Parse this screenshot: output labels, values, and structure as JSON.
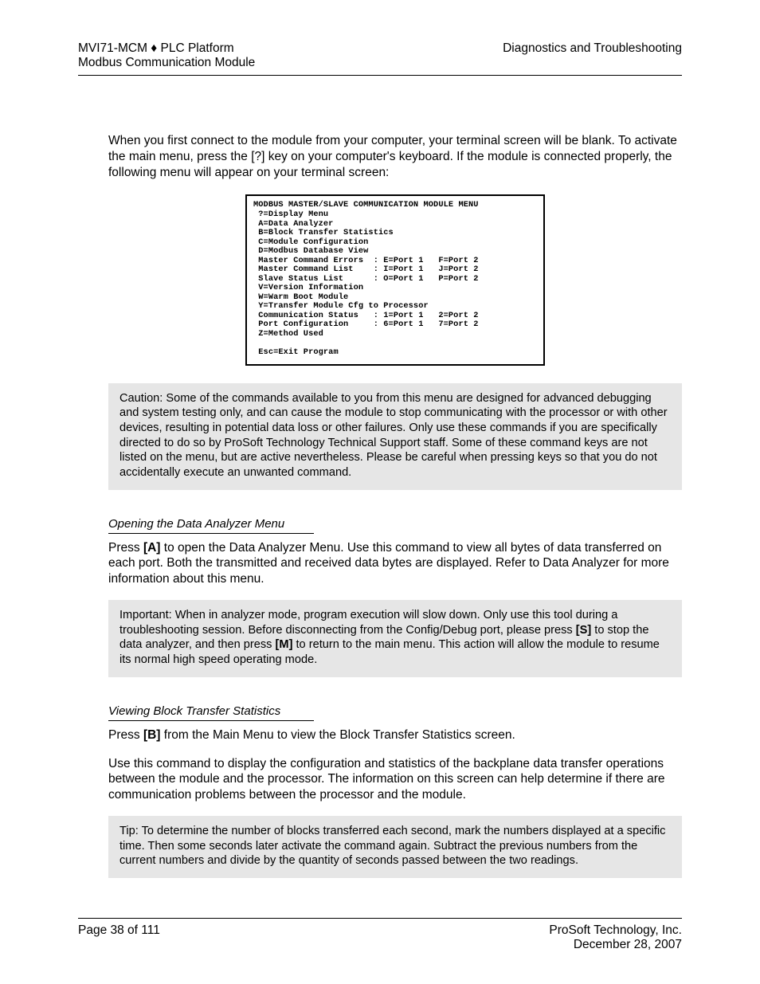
{
  "header": {
    "left_line1": "MVI71-MCM ♦ PLC Platform",
    "left_line2": "Modbus Communication Module",
    "right": "Diagnostics and Troubleshooting"
  },
  "intro": "When you first connect to the module from your computer, your terminal screen will be blank. To activate the main menu, press the [?] key on your computer's keyboard. If the module is connected properly, the following menu will appear on your terminal screen:",
  "terminal": "MODBUS MASTER/SLAVE COMMUNICATION MODULE MENU\n ?=Display Menu\n A=Data Analyzer\n B=Block Transfer Statistics\n C=Module Configuration\n D=Modbus Database View\n Master Command Errors  : E=Port 1   F=Port 2\n Master Command List    : I=Port 1   J=Port 2\n Slave Status List      : O=Port 1   P=Port 2\n V=Version Information\n W=Warm Boot Module\n Y=Transfer Module Cfg to Processor\n Communication Status   : 1=Port 1   2=Port 2\n Port Configuration     : 6=Port 1   7=Port 2\n Z=Method Used\n\n Esc=Exit Program",
  "caution": {
    "label": "Caution:",
    "text": "Some of the commands available to you from this menu are designed for advanced debugging and system testing only, and can cause the module to stop communicating with the processor or with other devices, resulting in potential data loss or other failures. Only use these commands if you are specifically directed to do so by ProSoft Technology Technical Support staff. Some of these command keys are not listed on the menu, but are active nevertheless. Please be careful when pressing keys so that you do not accidentally execute an unwanted command."
  },
  "sectionA": {
    "head": "Opening the Data Analyzer Menu",
    "press": "Press",
    "key": "[A]",
    "after": "to open the Data Analyzer Menu. Use this command to view all bytes of data transferred on each port. Both the transmitted and received data bytes are displayed. Refer to Data Analyzer for more information about this menu."
  },
  "important": {
    "label": "Important:",
    "pre": "When in analyzer mode, program execution will slow down. Only use this tool during a troubleshooting session. Before disconnecting from the Config/Debug port, please press",
    "key1": "[S]",
    "mid": "to stop the data analyzer, and then press",
    "key2": "[M]",
    "post": "to return to the main menu. This action will allow the module to resume its normal high speed operating mode."
  },
  "sectionB": {
    "head": "Viewing Block Transfer Statistics",
    "press": "Press",
    "key": "[B]",
    "after": "from the Main Menu to view the Block Transfer Statistics screen.",
    "para2": "Use this command to display the configuration and statistics of the backplane data transfer operations between the module and the processor. The information on this screen can help determine if there are communication problems between the processor and the module."
  },
  "tip": {
    "label": "Tip:",
    "text": "To determine the number of blocks transferred each second, mark the numbers displayed at a specific time. Then some seconds later activate the command again. Subtract the previous numbers from the current numbers and divide by the quantity of seconds passed between the two readings."
  },
  "footer": {
    "left": "Page 38 of 111",
    "right_line1": "ProSoft Technology, Inc.",
    "right_line2": "December 28, 2007"
  }
}
